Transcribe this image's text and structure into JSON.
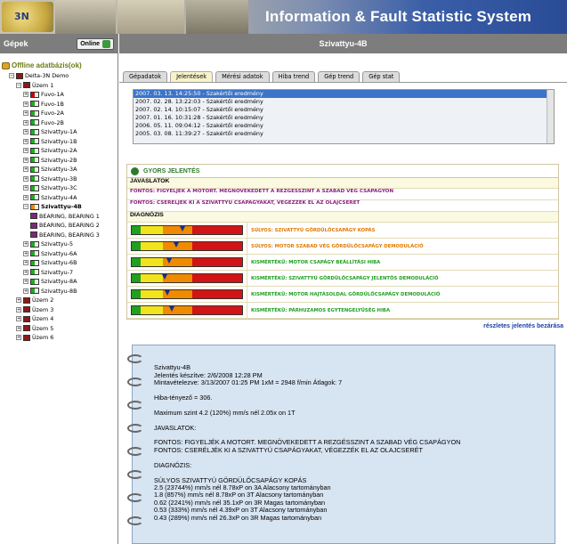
{
  "app": {
    "title": "Information & Fault Statistic System",
    "logo_text": "3N"
  },
  "left": {
    "title": "Gépek",
    "online_label": "Online",
    "tree": [
      {
        "label": "Offline adatbázis(ok)",
        "level": 0,
        "kind": "root",
        "icon": "database-icon"
      },
      {
        "label": "Delta-3N Demo",
        "level": 1,
        "kind": "node",
        "icon": "plant-icon",
        "toggle": "−"
      },
      {
        "label": "Üzem 1",
        "level": 2,
        "kind": "node",
        "icon": "plant-icon",
        "toggle": "−"
      },
      {
        "label": "Fuvo-1A",
        "level": 3,
        "status": "red",
        "toggle": "+"
      },
      {
        "label": "Fuvo-1B",
        "level": 3,
        "status": "green",
        "toggle": "+"
      },
      {
        "label": "Fuvo-2A",
        "level": 3,
        "status": "green",
        "toggle": "+"
      },
      {
        "label": "Fuvo-2B",
        "level": 3,
        "status": "green",
        "toggle": "+"
      },
      {
        "label": "Szivattyu-1A",
        "level": 3,
        "status": "green",
        "toggle": "+"
      },
      {
        "label": "Szivattyu-1B",
        "level": 3,
        "status": "green",
        "toggle": "+"
      },
      {
        "label": "Szivattyu-2A",
        "level": 3,
        "status": "green",
        "toggle": "+"
      },
      {
        "label": "Szivattyu-2B",
        "level": 3,
        "status": "green",
        "toggle": "+"
      },
      {
        "label": "Szivattyu-3A",
        "level": 3,
        "status": "green",
        "toggle": "+"
      },
      {
        "label": "Szivattyu-3B",
        "level": 3,
        "status": "green",
        "toggle": "+"
      },
      {
        "label": "Szivattyu-3C",
        "level": 3,
        "status": "green",
        "toggle": "+"
      },
      {
        "label": "Szivattyu-4A",
        "level": 3,
        "status": "green",
        "toggle": "+"
      },
      {
        "label": "Szivattyu-4B",
        "level": 3,
        "status": "orange",
        "toggle": "−",
        "selected": true
      },
      {
        "label": "BEARING, BEARING 1",
        "level": 4,
        "kind": "bearing"
      },
      {
        "label": "BEARING, BEARING 2",
        "level": 4,
        "kind": "bearing"
      },
      {
        "label": "BEARING, BEARING 3",
        "level": 4,
        "kind": "bearing"
      },
      {
        "label": "Szivattyu-5",
        "level": 3,
        "status": "green",
        "toggle": "+"
      },
      {
        "label": "Szivattyu-6A",
        "level": 3,
        "status": "green",
        "toggle": "+"
      },
      {
        "label": "Szivattyu-6B",
        "level": 3,
        "status": "green",
        "toggle": "+"
      },
      {
        "label": "Szivattyu-7",
        "level": 3,
        "status": "green",
        "toggle": "+"
      },
      {
        "label": "Szivattyu-8A",
        "level": 3,
        "status": "green",
        "toggle": "+"
      },
      {
        "label": "Szivattyu-8B",
        "level": 3,
        "status": "green",
        "toggle": "+"
      },
      {
        "label": "Üzem 2",
        "level": 2,
        "kind": "node",
        "icon": "plant-icon",
        "toggle": "+"
      },
      {
        "label": "Üzem 3",
        "level": 2,
        "kind": "node",
        "icon": "plant-icon",
        "toggle": "+"
      },
      {
        "label": "Üzem 4",
        "level": 2,
        "kind": "node",
        "icon": "plant-icon",
        "toggle": "+"
      },
      {
        "label": "Üzem 5",
        "level": 2,
        "kind": "node",
        "icon": "plant-icon",
        "toggle": "+"
      },
      {
        "label": "Üzem 6",
        "level": 2,
        "kind": "node",
        "icon": "plant-icon",
        "toggle": "+"
      }
    ]
  },
  "main": {
    "title": "Szivattyu-4B",
    "tabs": [
      {
        "label": "Gépadatok",
        "active": false
      },
      {
        "label": "Jelentések",
        "active": true
      },
      {
        "label": "Mérési adatok",
        "active": false
      },
      {
        "label": "Hiba trend",
        "active": false
      },
      {
        "label": "Gép trend",
        "active": false
      },
      {
        "label": "Gép stat",
        "active": false
      }
    ],
    "reports": [
      {
        "text": "2007. 03. 13. 14:25:50 - Szakértői eredmény",
        "selected": true
      },
      {
        "text": "2007. 02. 28. 13:22:03 - Szakértői eredmény",
        "selected": false
      },
      {
        "text": "2007. 02. 14. 10:15:07 - Szakértői eredmény",
        "selected": false
      },
      {
        "text": "2007. 01. 16. 10:31:28 - Szakértői eredmény",
        "selected": false
      },
      {
        "text": "2006. 05. 11. 09:04:12 - Szakértői eredmény",
        "selected": false
      },
      {
        "text": "2005. 03. 08. 11:39:27 - Szakértői eredmény",
        "selected": false
      }
    ],
    "quick": {
      "title": "GYORS JELENTÉS",
      "recommendations_title": "JAVASLATOK",
      "recommendations": [
        "FONTOS: FIGYELJÉK A MOTORT. MEGNÖVEKEDETT A REZGÉSSZINT A SZABAD VÉG CSAPÁGYON",
        "FONTOS: CSERÉLJÉK KI A SZIVATTYÚ CSAPÁGYAKAT, VÉGEZZÉK EL AZ OLAJCSERÉT"
      ],
      "diagnosis_title": "DIAGNÓZIS",
      "diagnoses": [
        {
          "text": "SÚLYOS: SZIVATTYÚ GÖRDÜLŐCSAPÁGY KOPÁS",
          "severity": 0.46,
          "color": "#e07a00"
        },
        {
          "text": "SÚLYOS: MOTOR SZABAD VÉG GÖRDÜLŐCSAPÁGY DEMODULÁCIÓ",
          "severity": 0.4,
          "color": "#e07a00"
        },
        {
          "text": "KISMÉRTÉKŰ: MOTOR CSAPÁGY BEÁLLÍTÁSI HIBA",
          "severity": 0.34,
          "color": "#1fa01f"
        },
        {
          "text": "KISMÉRTÉKŰ: SZIVATTYÚ GÖRDÜLŐCSAPÁGY JELENTŐS DEMODULÁCIÓ",
          "severity": 0.3,
          "color": "#1fa01f"
        },
        {
          "text": "KISMÉRTÉKŰ: MOTOR HAJTÁSOLDAL GÖRDÜLŐCSAPÁGY DEMODULÁCIÓ",
          "severity": 0.32,
          "color": "#1fa01f"
        },
        {
          "text": "KISMÉRTÉKŰ: PÁRHUZAMOS EGYTENGELYŰSÉG HIBA",
          "severity": 0.36,
          "color": "#1fa01f"
        }
      ],
      "close_link": "részletes jelentés bezárása"
    },
    "detail": {
      "machine": "Szivattyu-4B",
      "created": "Jelentés készítve: 2/6/2008 12:28 PM",
      "sampling": "Mintavételezve: 3/13/2007 01:25 PM 1xM = 2948 f/min Átlagok: 7",
      "fault_factor": "Hiba-tényező = 306.",
      "max_level": "Maximum szint 4.2 (120%) mm/s nél 2.05x on 1T",
      "rec_title": "JAVASLATOK:",
      "rec_1": "FONTOS: FIGYELJÉK A MOTORT. MEGNÖVEKEDETT A REZGÉSSZINT A SZABAD VÉG CSAPÁGYON",
      "rec_2": "FONTOS: CSERÉLJÉK KI A SZIVATTYÚ CSAPÁGYAKAT, VÉGEZZÉK EL AZ OLAJCSERÉT",
      "diag_title": "DIAGNÓZIS:",
      "diag_1": "SÚLYOS SZIVATTYÚ GÖRDÜLŐCSAPÁGY KOPÁS",
      "line_1": "2.5 (23744%) mm/s nél 8.78xP on 3A Alacsony tartományban",
      "line_2": "1.8 (857%) mm/s nél 8.78xP on 3T Alacsony tartományban",
      "line_3": "0.62 (2241%) mm/s nél 35.1xP on 3R Magas tartományban",
      "line_4": "0.53 (333%) mm/s nél 4.39xP on 3T Alacsony tartományban",
      "line_5": "0.43 (289%) mm/s nél 26.3xP on 3R Magas tartományban"
    }
  },
  "colors": {
    "header_bg": "#7d7d7d",
    "tab_active": "#f7f3c9",
    "notebook_bg": "#d7e4f2",
    "link": "#1a3ea8",
    "rec_text": "#8b1a8b"
  }
}
